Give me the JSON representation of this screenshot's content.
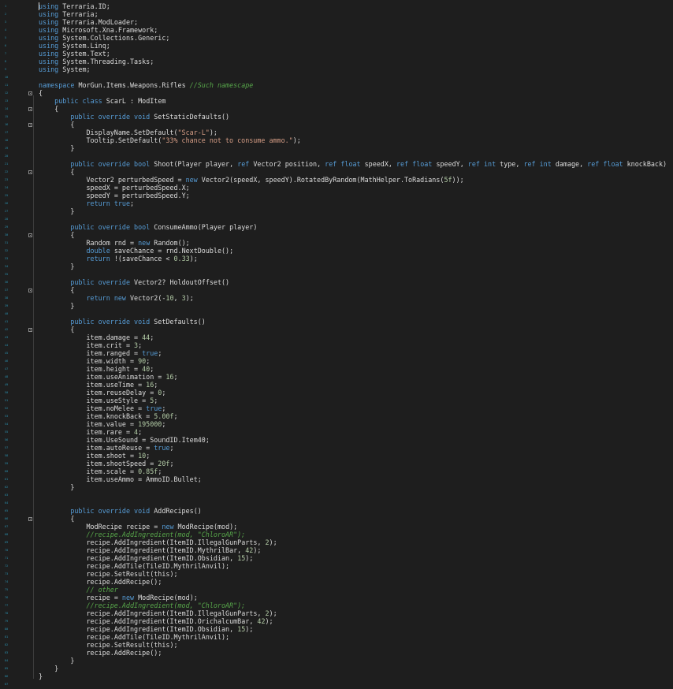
{
  "editor": {
    "lines": [
      "using Terraria.ID;",
      "using Terraria;",
      "using Terraria.ModLoader;",
      "using Microsoft.Xna.Framework;",
      "using System.Collections.Generic;",
      "using System.Linq;",
      "using System.Text;",
      "using System.Threading.Tasks;",
      "using System;",
      "",
      "namespace MorGun.Items.Weapons.Rifles //Such namescape",
      "{",
      "    public class ScarL : ModItem",
      "    {",
      "        public override void SetStaticDefaults()",
      "        {",
      "            DisplayName.SetDefault(\"Scar-L\");",
      "            Tooltip.SetDefault(\"33% chance not to consume ammo.\");",
      "        }",
      "",
      "        public override bool Shoot(Player player, ref Vector2 position, ref float speedX, ref float speedY, ref int type, ref int damage, ref float knockBack)",
      "        {",
      "            Vector2 perturbedSpeed = new Vector2(speedX, speedY).RotatedByRandom(MathHelper.ToRadians(5f));",
      "            speedX = perturbedSpeed.X;",
      "            speedY = perturbedSpeed.Y;",
      "            return true;",
      "        }",
      "",
      "        public override bool ConsumeAmmo(Player player)",
      "        {",
      "            Random rnd = new Random();",
      "            double saveChance = rnd.NextDouble();",
      "            return !(saveChance < 0.33);",
      "        }",
      "",
      "        public override Vector2? HoldoutOffset()",
      "        {",
      "            return new Vector2(-10, 3);",
      "        }",
      "",
      "        public override void SetDefaults()",
      "        {",
      "            item.damage = 44;",
      "            item.crit = 3;",
      "            item.ranged = true;",
      "            item.width = 90;",
      "            item.height = 40;",
      "            item.useAnimation = 16;",
      "            item.useTime = 16;",
      "            item.reuseDelay = 0;",
      "            item.useStyle = 5;",
      "            item.noMelee = true;",
      "            item.knockBack = 5.00f;",
      "            item.value = 195000;",
      "            item.rare = 4;",
      "            item.UseSound = SoundID.Item40;",
      "            item.autoReuse = true;",
      "            item.shoot = 10;",
      "            item.shootSpeed = 20f;",
      "            item.scale = 0.85f;",
      "            item.useAmmo = AmmoID.Bullet;",
      "        }",
      "",
      "",
      "        public override void AddRecipes()",
      "        {",
      "            ModRecipe recipe = new ModRecipe(mod);",
      "            //recipe.AddIngredient(mod, \"ChloroAR\");",
      "            recipe.AddIngredient(ItemID.IllegalGunParts, 2);",
      "            recipe.AddIngredient(ItemID.MythrilBar, 42);",
      "            recipe.AddIngredient(ItemID.Obsidian, 15);",
      "            recipe.AddTile(TileID.MythrilAnvil);",
      "            recipe.SetResult(this);",
      "            recipe.AddRecipe();",
      "            // other",
      "            recipe = new ModRecipe(mod);",
      "            //recipe.AddIngredient(mod, \"ChloroAR\");",
      "            recipe.AddIngredient(ItemID.IllegalGunParts, 2);",
      "            recipe.AddIngredient(ItemID.OrichalcumBar, 42);",
      "            recipe.AddIngredient(ItemID.Obsidian, 15);",
      "            recipe.AddTile(TileID.MythrilAnvil);",
      "            recipe.SetResult(this);",
      "            recipe.AddRecipe();",
      "        }",
      "    }",
      "}",
      ""
    ],
    "fold_lines": [
      12,
      14,
      16,
      22,
      30,
      37,
      42,
      66
    ],
    "colors": {
      "background": "#1e1e1e",
      "text": "#dcdcdc",
      "keyword": "#569cd6",
      "string": "#d69d85",
      "number": "#b5cea8",
      "comment": "#57a64a",
      "line_number": "#2b91af"
    }
  }
}
